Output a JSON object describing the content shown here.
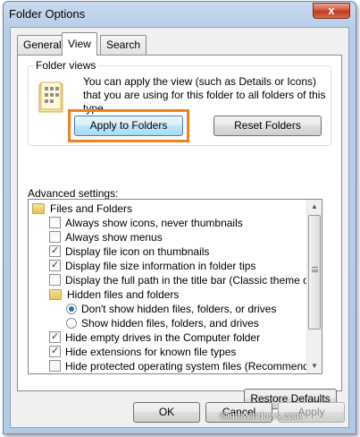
{
  "window": {
    "title": "Folder Options",
    "close_glyph": "x"
  },
  "tabs": [
    {
      "label": "General"
    },
    {
      "label": "View"
    },
    {
      "label": "Search"
    }
  ],
  "folder_views": {
    "label": "Folder views",
    "description": "You can apply the view (such as Details or Icons) that you are using for this folder to all folders of this type.",
    "apply_button": "Apply to Folders",
    "reset_button": "Reset Folders",
    "icon": "folder-view-icon"
  },
  "advanced": {
    "label": "Advanced settings:",
    "items": [
      {
        "type": "folder",
        "label": "Files and Folders"
      },
      {
        "type": "checkbox",
        "label": "Always show icons, never thumbnails",
        "checked": false
      },
      {
        "type": "checkbox",
        "label": "Always show menus",
        "checked": false
      },
      {
        "type": "checkbox",
        "label": "Display file icon on thumbnails",
        "checked": true
      },
      {
        "type": "checkbox",
        "label": "Display file size information in folder tips",
        "checked": true
      },
      {
        "type": "checkbox",
        "label": "Display the full path in the title bar (Classic theme only)",
        "checked": false
      },
      {
        "type": "folder",
        "label": "Hidden files and folders"
      },
      {
        "type": "radio",
        "label": "Don't show hidden files, folders, or drives",
        "checked": true
      },
      {
        "type": "radio",
        "label": "Show hidden files, folders, and drives",
        "checked": false
      },
      {
        "type": "checkbox",
        "label": "Hide empty drives in the Computer folder",
        "checked": true
      },
      {
        "type": "checkbox",
        "label": "Hide extensions for known file types",
        "checked": true
      },
      {
        "type": "checkbox",
        "label": "Hide protected operating system files (Recommended)",
        "checked": false
      }
    ],
    "restore_button": "Restore Defaults"
  },
  "footer": {
    "ok": "OK",
    "cancel": "Cancel",
    "apply": "Apply",
    "watermark": "©intowindows.com"
  },
  "colors": {
    "highlight": "#f0821e",
    "title_bar": "#b9cde8",
    "close_button": "#c0391e"
  }
}
